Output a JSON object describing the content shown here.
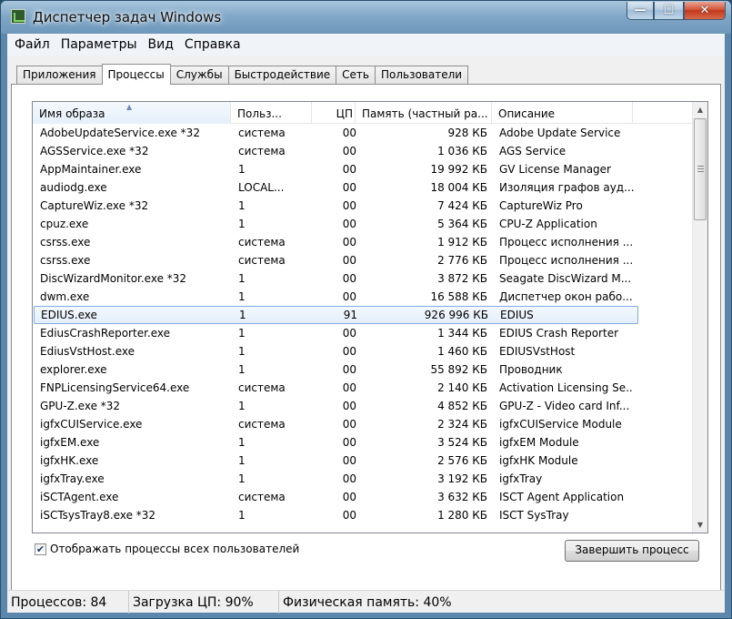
{
  "window": {
    "title": "Диспетчер задач Windows",
    "controls": {
      "minimize": "—",
      "maximize": "☐",
      "close": "✕"
    }
  },
  "menu": [
    "Файл",
    "Параметры",
    "Вид",
    "Справка"
  ],
  "tabs": [
    {
      "label": "Приложения",
      "active": false
    },
    {
      "label": "Процессы",
      "active": true
    },
    {
      "label": "Службы",
      "active": false
    },
    {
      "label": "Быстродействие",
      "active": false
    },
    {
      "label": "Сеть",
      "active": false
    },
    {
      "label": "Пользователи",
      "active": false
    }
  ],
  "columns": {
    "name": "Имя образа",
    "user": "Польз...",
    "cpu": "ЦП",
    "memory": "Память (частный ра...",
    "description": "Описание"
  },
  "processes": [
    {
      "name": "AdobeUpdateService.exe *32",
      "user": "система",
      "cpu": "00",
      "memory": "928 КБ",
      "description": "Adobe Update Service"
    },
    {
      "name": "AGSService.exe *32",
      "user": "система",
      "cpu": "00",
      "memory": "1 036 КБ",
      "description": "AGS Service"
    },
    {
      "name": "AppMaintainer.exe",
      "user": "1",
      "cpu": "00",
      "memory": "19 992 КБ",
      "description": "GV License Manager"
    },
    {
      "name": "audiodg.exe",
      "user": "LOCAL...",
      "cpu": "00",
      "memory": "18 004 КБ",
      "description": "Изоляция графов ауд..."
    },
    {
      "name": "CaptureWiz.exe *32",
      "user": "1",
      "cpu": "00",
      "memory": "7 424 КБ",
      "description": "CaptureWiz Pro"
    },
    {
      "name": "cpuz.exe",
      "user": "1",
      "cpu": "00",
      "memory": "5 364 КБ",
      "description": "CPU-Z Application"
    },
    {
      "name": "csrss.exe",
      "user": "система",
      "cpu": "00",
      "memory": "1 912 КБ",
      "description": "Процесс исполнения ..."
    },
    {
      "name": "csrss.exe",
      "user": "система",
      "cpu": "00",
      "memory": "2 776 КБ",
      "description": "Процесс исполнения ..."
    },
    {
      "name": "DiscWizardMonitor.exe *32",
      "user": "1",
      "cpu": "00",
      "memory": "3 872 КБ",
      "description": "Seagate DiscWizard M..."
    },
    {
      "name": "dwm.exe",
      "user": "1",
      "cpu": "00",
      "memory": "16 588 КБ",
      "description": "Диспетчер окон рабо..."
    },
    {
      "name": "EDIUS.exe",
      "user": "1",
      "cpu": "91",
      "memory": "926 996 КБ",
      "description": "EDIUS",
      "selected": true
    },
    {
      "name": "EdiusCrashReporter.exe",
      "user": "1",
      "cpu": "00",
      "memory": "1 344 КБ",
      "description": "EDIUS Crash Reporter"
    },
    {
      "name": "EdiusVstHost.exe",
      "user": "1",
      "cpu": "00",
      "memory": "1 460 КБ",
      "description": "EDIUSVstHost"
    },
    {
      "name": "explorer.exe",
      "user": "1",
      "cpu": "00",
      "memory": "55 892 КБ",
      "description": "Проводник"
    },
    {
      "name": "FNPLicensingService64.exe",
      "user": "система",
      "cpu": "00",
      "memory": "2 140 КБ",
      "description": "Activation Licensing Se..."
    },
    {
      "name": "GPU-Z.exe *32",
      "user": "1",
      "cpu": "00",
      "memory": "4 852 КБ",
      "description": "GPU-Z - Video card Inf..."
    },
    {
      "name": "igfxCUIService.exe",
      "user": "система",
      "cpu": "00",
      "memory": "2 324 КБ",
      "description": "igfxCUIService Module"
    },
    {
      "name": "igfxEM.exe",
      "user": "1",
      "cpu": "00",
      "memory": "3 524 КБ",
      "description": "igfxEM Module"
    },
    {
      "name": "igfxHK.exe",
      "user": "1",
      "cpu": "00",
      "memory": "2 576 КБ",
      "description": "igfxHK Module"
    },
    {
      "name": "igfxTray.exe",
      "user": "1",
      "cpu": "00",
      "memory": "3 192 КБ",
      "description": "igfxTray"
    },
    {
      "name": "iSCTAgent.exe",
      "user": "система",
      "cpu": "00",
      "memory": "3 632 КБ",
      "description": "ISCT Agent Application"
    },
    {
      "name": "iSCTsysTray8.exe *32",
      "user": "1",
      "cpu": "00",
      "memory": "1 280 КБ",
      "description": "ISCT SysTray"
    }
  ],
  "show_all_users": {
    "label": "Отображать процессы всех пользователей",
    "checked": true
  },
  "end_process_button": "Завершить процесс",
  "status": {
    "processes": "Процессов: 84",
    "cpu": "Загрузка ЦП: 90%",
    "memory": "Физическая память: 40%"
  }
}
